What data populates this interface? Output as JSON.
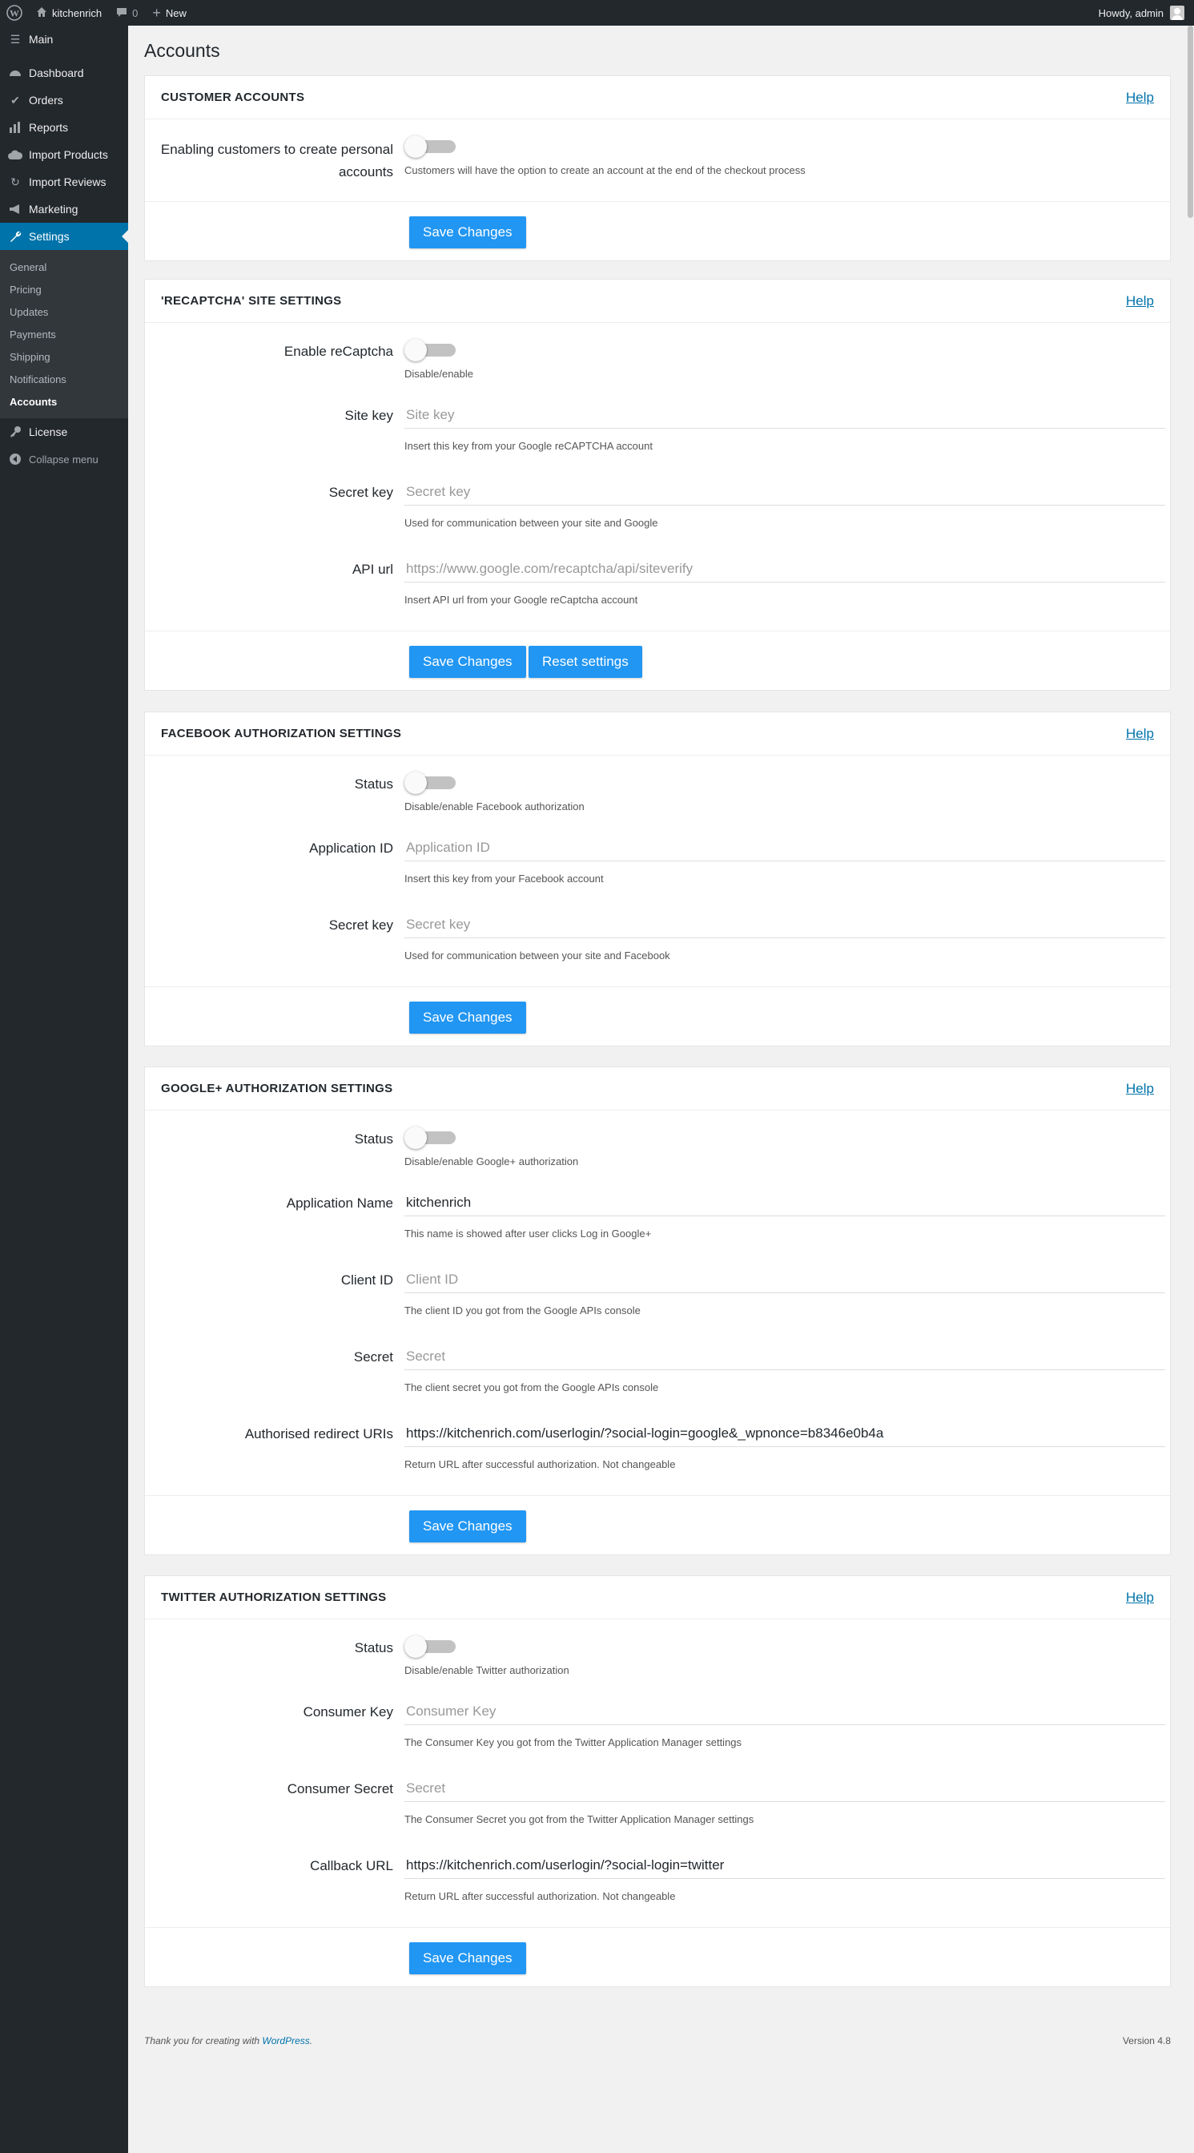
{
  "adminbar": {
    "site_name": "kitchenrich",
    "comments_count": "0",
    "new_label": "New",
    "howdy": "Howdy, admin"
  },
  "sidebar": {
    "main_label": "Main",
    "items": [
      {
        "label": "Dashboard",
        "icon": "dashboard-icon"
      },
      {
        "label": "Orders",
        "icon": "check-icon"
      },
      {
        "label": "Reports",
        "icon": "chart-icon"
      },
      {
        "label": "Import Products",
        "icon": "cloud-icon"
      },
      {
        "label": "Import Reviews",
        "icon": "refresh-icon"
      },
      {
        "label": "Marketing",
        "icon": "megaphone-icon"
      },
      {
        "label": "Settings",
        "icon": "wrench-icon"
      }
    ],
    "submenu": [
      "General",
      "Pricing",
      "Updates",
      "Payments",
      "Shipping",
      "Notifications",
      "Accounts"
    ],
    "license_label": "License",
    "collapse_label": "Collapse menu"
  },
  "page": {
    "title": "Accounts"
  },
  "help_label": "Help",
  "save_label": "Save Changes",
  "reset_label": "Reset settings",
  "sections": {
    "customer": {
      "title": "CUSTOMER ACCOUNTS",
      "label": "Enabling customers to create personal accounts",
      "desc": "Customers will have the option to create an account at the end of the checkout process"
    },
    "recaptcha": {
      "title": "'RECAPTCHA' SITE SETTINGS",
      "enable_label": "Enable reCaptcha",
      "enable_desc": "Disable/enable",
      "site_key_label": "Site key",
      "site_key_placeholder": "Site key",
      "site_key_desc": "Insert this key from your Google reCAPTCHA account",
      "secret_label": "Secret key",
      "secret_placeholder": "Secret key",
      "secret_desc": "Used for communication between your site and Google",
      "api_label": "API url",
      "api_placeholder": "https://www.google.com/recaptcha/api/siteverify",
      "api_desc": "Insert API url from your Google reCaptcha account"
    },
    "facebook": {
      "title": "FACEBOOK AUTHORIZATION SETTINGS",
      "status_label": "Status",
      "status_desc": "Disable/enable Facebook authorization",
      "app_id_label": "Application ID",
      "app_id_placeholder": "Application ID",
      "app_id_desc": "Insert this key from your Facebook account",
      "secret_label": "Secret key",
      "secret_placeholder": "Secret key",
      "secret_desc": "Used for communication between your site and Facebook"
    },
    "google": {
      "title": "GOOGLE+ AUTHORIZATION SETTINGS",
      "status_label": "Status",
      "status_desc": "Disable/enable Google+ authorization",
      "app_name_label": "Application Name",
      "app_name_value": "kitchenrich",
      "app_name_desc": "This name is showed after user clicks Log in Google+",
      "client_id_label": "Client ID",
      "client_id_placeholder": "Client ID",
      "client_id_desc": "The client ID you got from the Google APIs console",
      "secret_label": "Secret",
      "secret_placeholder": "Secret",
      "secret_desc": "The client secret you got from the Google APIs console",
      "redirect_label": "Authorised redirect URIs",
      "redirect_value": "https://kitchenrich.com/userlogin/?social-login=google&_wpnonce=b8346e0b4a",
      "redirect_desc": "Return URL after successful authorization. Not changeable"
    },
    "twitter": {
      "title": "TWITTER AUTHORIZATION SETTINGS",
      "status_label": "Status",
      "status_desc": "Disable/enable Twitter authorization",
      "key_label": "Consumer Key",
      "key_placeholder": "Consumer Key",
      "key_desc": "The Consumer Key you got from the Twitter Application Manager settings",
      "secret_label": "Consumer Secret",
      "secret_placeholder": "Secret",
      "secret_desc": "The Consumer Secret you got from the Twitter Application Manager settings",
      "callback_label": "Callback URL",
      "callback_value": "https://kitchenrich.com/userlogin/?social-login=twitter",
      "callback_desc": "Return URL after successful authorization. Not changeable"
    }
  },
  "footer": {
    "thanks_prefix": "Thank you for creating with ",
    "thanks_link": "WordPress",
    "thanks_suffix": ".",
    "version": "Version 4.8"
  },
  "colors": {
    "accent": "#0073aa",
    "button": "#2196f3",
    "sidebar": "#23282d"
  }
}
